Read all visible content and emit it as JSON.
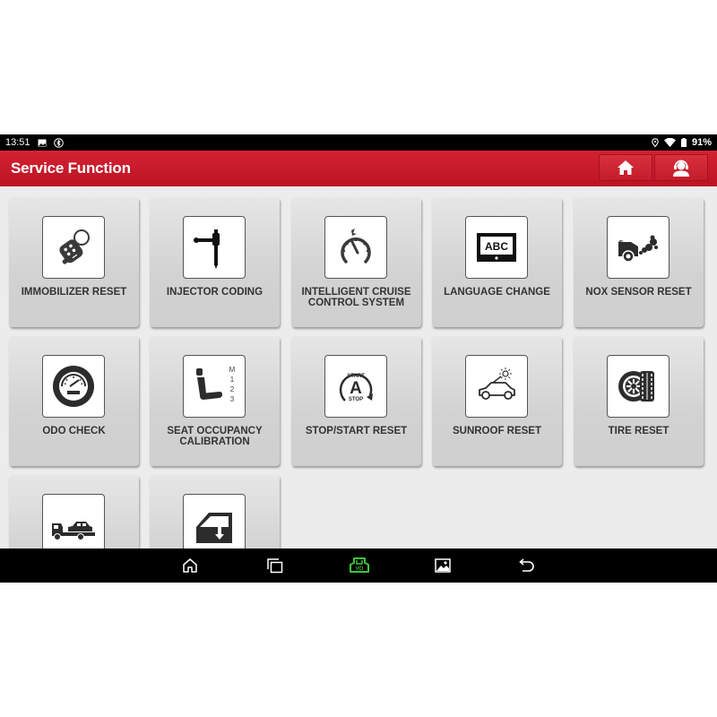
{
  "status_bar": {
    "time": "13:51",
    "left_icons": [
      "image-notification-icon",
      "bluetooth-icon"
    ],
    "right_icons": [
      "location-icon",
      "wifi-icon",
      "battery-icon"
    ],
    "battery": "91%"
  },
  "header": {
    "title": "Service Function",
    "buttons": [
      {
        "name": "home-button",
        "icon": "home-icon"
      },
      {
        "name": "support-button",
        "icon": "support-agent-icon"
      }
    ],
    "color": "#c81a2a"
  },
  "tiles": [
    {
      "label": "IMMOBILIZER RESET",
      "icon": "car-key-fob-icon"
    },
    {
      "label": "INJECTOR CODING",
      "icon": "injector-icon"
    },
    {
      "label": "INTELLIGENT CRUISE CONTROL SYSTEM",
      "icon": "speedometer-cruise-icon"
    },
    {
      "label": "LANGUAGE CHANGE",
      "icon": "abc-screen-icon"
    },
    {
      "label": "NOX SENSOR RESET",
      "icon": "car-exhaust-icon"
    },
    {
      "label": "ODO CHECK",
      "icon": "odometer-gauge-icon"
    },
    {
      "label": "SEAT OCCUPANCY CALIBRATION",
      "icon": "seat-memory-icon",
      "icon_text": [
        "M",
        "1",
        "2",
        "3"
      ]
    },
    {
      "label": "STOP/START RESET",
      "icon": "auto-start-stop-icon",
      "icon_text": [
        "START",
        "A",
        "STOP"
      ]
    },
    {
      "label": "SUNROOF RESET",
      "icon": "car-sunroof-icon"
    },
    {
      "label": "TIRE RESET",
      "icon": "tire-icon"
    },
    {
      "label": "",
      "icon": "tow-truck-icon"
    },
    {
      "label": "",
      "icon": "window-lift-icon"
    }
  ],
  "nav_bar": {
    "items": [
      {
        "name": "nav-home",
        "icon": "home-outline-icon"
      },
      {
        "name": "nav-recents",
        "icon": "recent-apps-icon"
      },
      {
        "name": "nav-vci",
        "icon": "vci-connector-icon",
        "text": "VCI",
        "color": "#3cc43c"
      },
      {
        "name": "nav-screenshot",
        "icon": "gallery-icon"
      },
      {
        "name": "nav-back",
        "icon": "back-icon"
      }
    ]
  }
}
